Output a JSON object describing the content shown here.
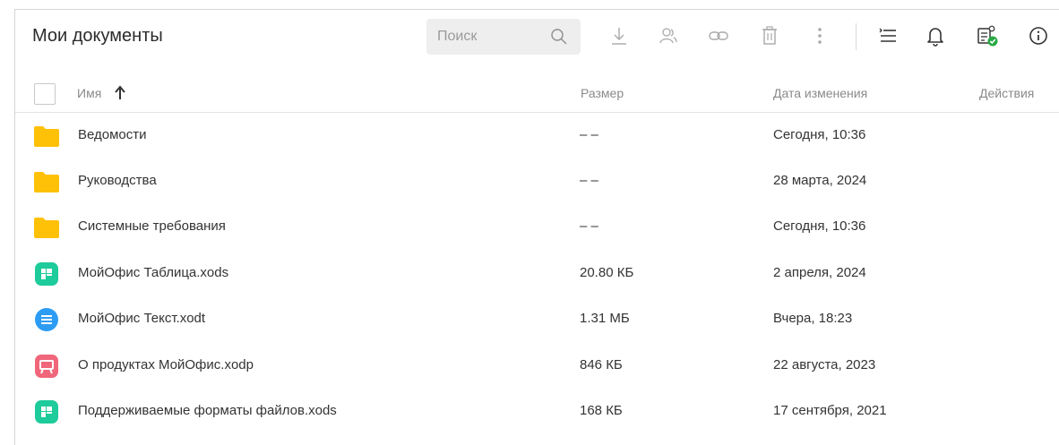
{
  "header": {
    "title": "Мои документы",
    "search_placeholder": "Поиск"
  },
  "toolbar": {
    "icons": [
      "download-icon",
      "share-users-icon",
      "link-icon",
      "trash-icon",
      "more-vert-icon",
      "sort-list-icon",
      "bell-icon",
      "tasks-check-icon",
      "info-icon"
    ]
  },
  "table": {
    "columns": {
      "name": "Имя",
      "size": "Размер",
      "modified": "Дата изменения",
      "actions": "Действия"
    },
    "sort": "ascending",
    "rows": [
      {
        "type": "folder",
        "name": "Ведомости",
        "size": "– –",
        "modified": "Сегодня, 10:36"
      },
      {
        "type": "folder",
        "name": "Руководства",
        "size": "– –",
        "modified": "28 марта, 2024"
      },
      {
        "type": "folder",
        "name": "Системные требования",
        "size": "– –",
        "modified": "Сегодня, 10:36"
      },
      {
        "type": "table",
        "name": "МойОфис Таблица.xods",
        "size": "20.80 КБ",
        "modified": "2 апреля, 2024"
      },
      {
        "type": "text",
        "name": "МойОфис Текст.xodt",
        "size": "1.31 МБ",
        "modified": "Вчера, 18:23"
      },
      {
        "type": "presentation",
        "name": "О продуктах МойОфис.xodp",
        "size": "846 КБ",
        "modified": "22 августа, 2023"
      },
      {
        "type": "table",
        "name": "Поддерживаемые форматы файлов.xods",
        "size": "168 КБ",
        "modified": "17 сентября, 2021"
      }
    ]
  },
  "colors": {
    "folder": "#FFC107",
    "table": "#1ECB9A",
    "text": "#2D9CF5",
    "presentation": "#F0667A",
    "status_ok": "#27A844"
  }
}
